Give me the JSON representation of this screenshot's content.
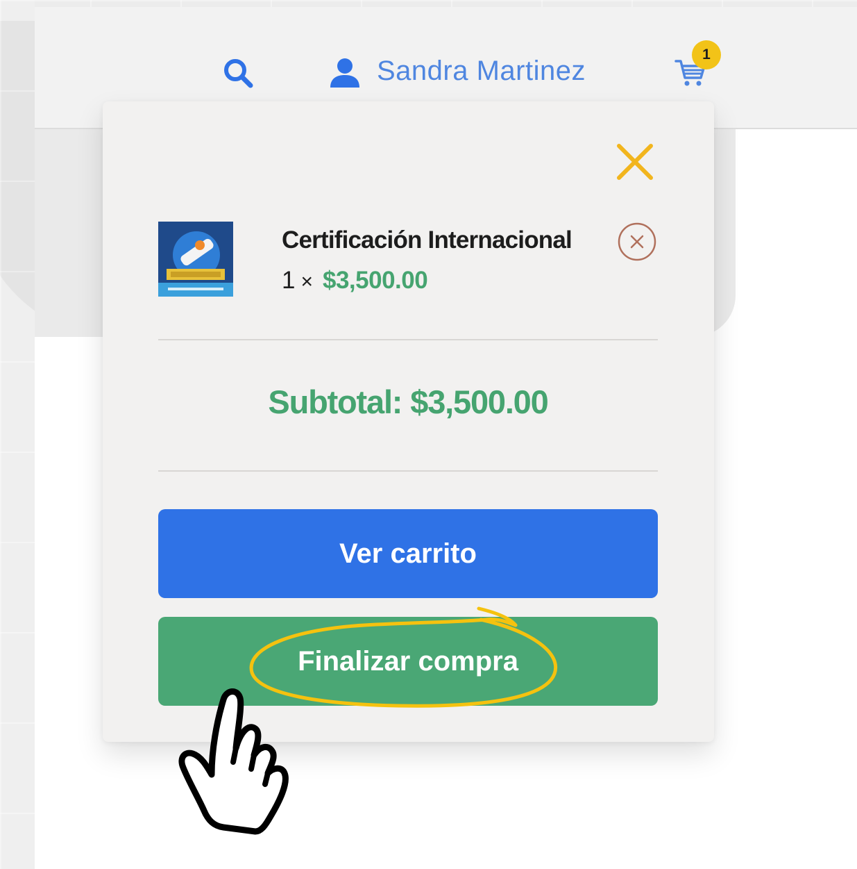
{
  "header": {
    "user_name": "Sandra Martinez",
    "cart_count": "1",
    "icons": [
      "search-icon",
      "user-icon",
      "cart-icon"
    ]
  },
  "cart_panel": {
    "close_icon": "close-icon",
    "item": {
      "name": "Certificación Internacional",
      "quantity": "1",
      "times": "×",
      "price": "$3,500.00",
      "remove_icon": "remove-circle-icon"
    },
    "subtotal_label": "Subtotal:",
    "subtotal_value": "$3,500.00",
    "view_cart_label": "Ver carrito",
    "checkout_label": "Finalizar compra"
  },
  "colors": {
    "accent_blue": "#2f72e6",
    "user_blue": "#4f86e0",
    "price_green": "#46a470",
    "checkout_green": "#4aa775",
    "close_yellow": "#f2b51d",
    "badge_yellow": "#f2c318",
    "highlight_yellow": "#f5c20f"
  }
}
